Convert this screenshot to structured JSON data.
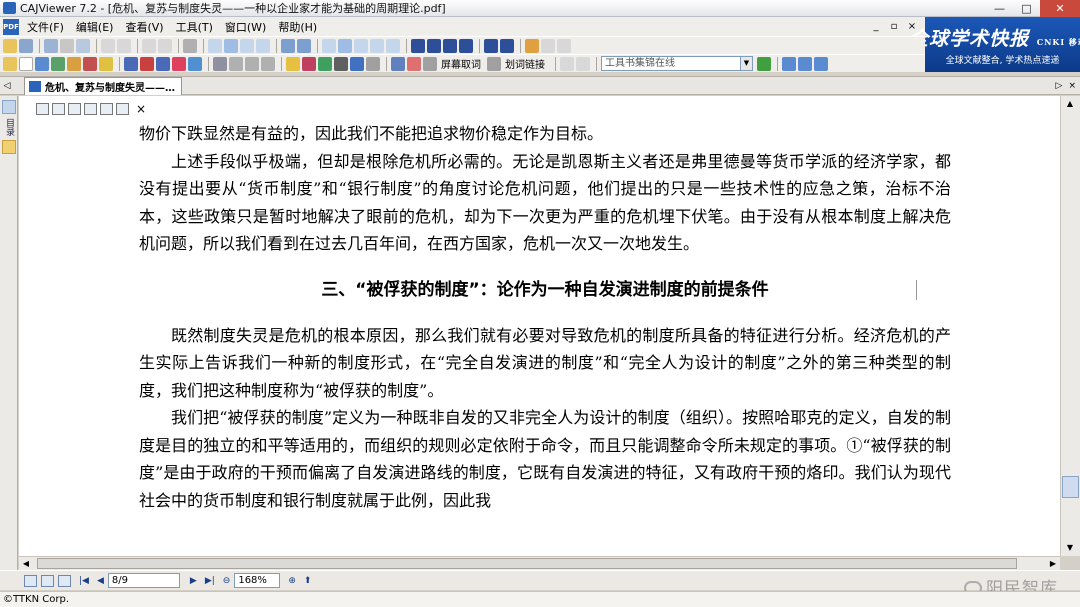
{
  "window": {
    "title": "CAJViewer 7.2 - [危机、复苏与制度失灵——一种以企业家才能为基础的周期理论.pdf]",
    "minimize": "—",
    "maximize": "□",
    "close": "✕"
  },
  "menu": {
    "items": [
      "文件(F)",
      "编辑(E)",
      "查看(V)",
      "工具(T)",
      "窗口(W)",
      "帮助(H)"
    ],
    "mdi_minimize": "_",
    "mdi_restore": "▫",
    "mdi_close": "×"
  },
  "banner": {
    "title": "全球学术快报",
    "cnki": "CNKI 移动版",
    "subtitle": "全球文献整合, 学术热点速递"
  },
  "toolbar": {
    "screen_select_label": "屏幕取词",
    "link_label": "划词链接",
    "search_placeholder": "工具书集锦在线"
  },
  "tab": {
    "label": "危机、复苏与制度失灵——…",
    "left_arrow": "◁",
    "right_arrow": "▷",
    "close": "×"
  },
  "sidebar": {
    "label": "目录"
  },
  "document": {
    "paragraphs_before": [
      {
        "text": "物价下跌显然是有益的，因此我们不能把追求物价稳定作为目标。",
        "indent": false
      },
      {
        "text": "上述手段似乎极端，但却是根除危机所必需的。无论是凯恩斯主义者还是弗里德曼等货币学派的经济学家，都没有提出要从“货币制度”和“银行制度”的角度讨论危机问题，他们提出的只是一些技术性的应急之策，治标不治本，这些政策只是暂时地解决了眼前的危机，却为下一次更为严重的危机埋下伏笔。由于没有从根本制度上解决危机问题，所以我们看到在过去几百年间，在西方国家，危机一次又一次地发生。",
        "indent": true
      }
    ],
    "heading": "三、“被俘获的制度”：论作为一种自发演进制度的前提条件",
    "paragraphs_after": [
      {
        "text": "既然制度失灵是危机的根本原因，那么我们就有必要对导致危机的制度所具备的特征进行分析。经济危机的产生实际上告诉我们一种新的制度形式，在“完全自发演进的制度”和“完全人为设计的制度”之外的第三种类型的制度，我们把这种制度称为“被俘获的制度”。",
        "indent": true
      },
      {
        "text": "我们把“被俘获的制度”定义为一种既非自发的又非完全人为设计的制度（组织）。按照哈耶克的定义，自发的制度是目的独立的和平等适用的，而组织的规则必定依附于命令，而且只能调整命令所未规定的事项。①“被俘获的制度”是由于政府的干预而偏离了自发演进路线的制度，它既有自发演进的特征，又有政府干预的烙印。我们认为现代社会中的货币制度和银行制度就属于此例，因此我",
        "indent": true
      }
    ]
  },
  "statusbar": {
    "page": "8/9",
    "zoom": "168%"
  },
  "watermark": "阳民智库",
  "copyright": "©TTKN Corp."
}
